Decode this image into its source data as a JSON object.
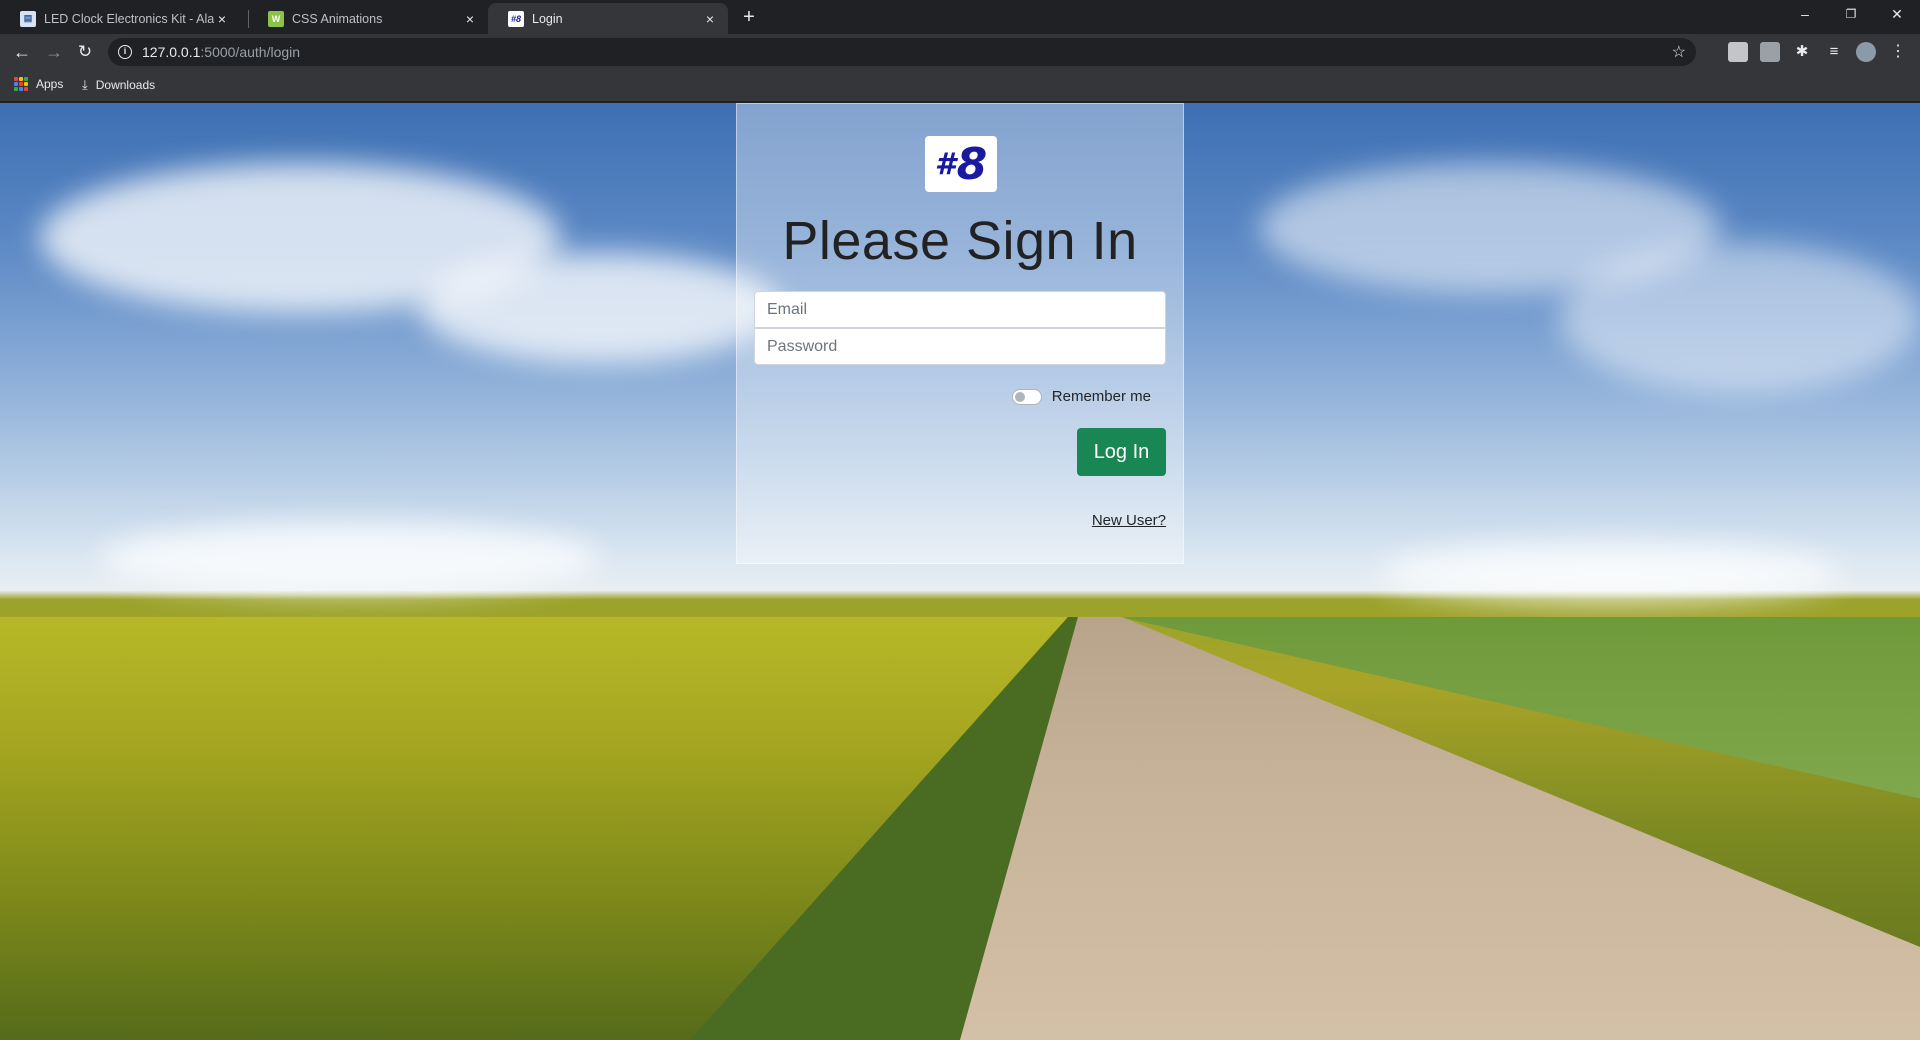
{
  "browser": {
    "tabs": [
      {
        "title": "LED Clock Electronics Kit - Alarm",
        "favicon": "document-icon",
        "active": false
      },
      {
        "title": "CSS Animations",
        "favicon": "css-icon",
        "active": false
      },
      {
        "title": "Login",
        "favicon": "#8",
        "active": true
      }
    ],
    "new_tab": "+",
    "window_controls": {
      "minimize": "–",
      "restore": "❐",
      "close": "✕"
    },
    "url": {
      "host": "127.0.0.1",
      "path": ":5000/auth/login"
    },
    "bookmarks": [
      {
        "label": "Apps",
        "icon": "apps-grid-icon"
      },
      {
        "label": "Downloads",
        "icon": "download-icon"
      }
    ]
  },
  "login": {
    "logo": {
      "hash": "#",
      "digit": "8"
    },
    "heading": "Please Sign In",
    "email_placeholder": "Email",
    "password_placeholder": "Password",
    "remember_label": "Remember me",
    "remember_checked": false,
    "submit_label": "Log In",
    "new_user_link": "New User?"
  },
  "colors": {
    "submit_button": "#198754",
    "logo_text": "#1a1aa0",
    "chrome_dark": "#202124",
    "chrome_toolbar": "#35363a"
  }
}
